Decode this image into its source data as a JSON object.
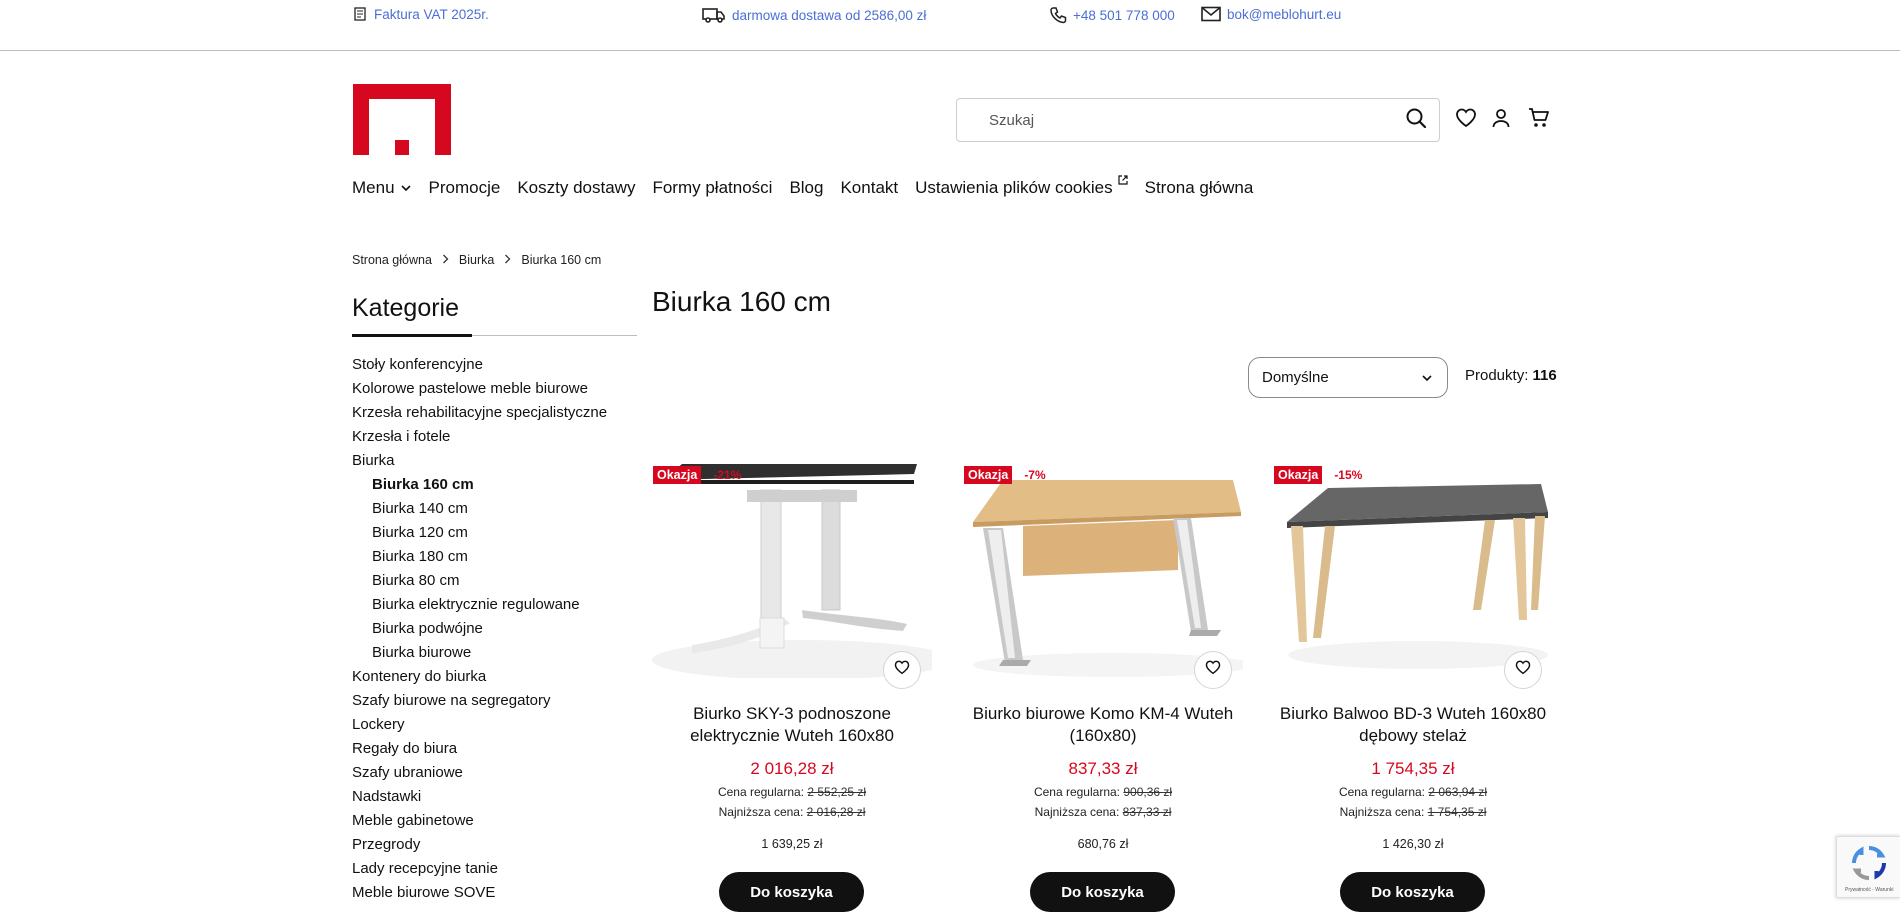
{
  "topbar": {
    "vat": "Faktura VAT 2025r.",
    "delivery": "darmowa dostawa od 2586,00 zł",
    "phone": "+48 501 778 000",
    "email": "bok@meblohurt.eu"
  },
  "colors": {
    "accent": "#d6081f",
    "link": "#4a6fd6",
    "dark": "#111111"
  },
  "header": {
    "logo": "meblohurt-logo",
    "search_placeholder": "Szukaj",
    "icons": [
      "search-icon",
      "heart-icon",
      "user-icon",
      "cart-icon"
    ]
  },
  "nav": {
    "menu": "Menu",
    "items": [
      "Promocje",
      "Koszty dostawy",
      "Formy płatności",
      "Blog",
      "Kontakt",
      "Ustawienia plików cookies",
      "Strona główna"
    ]
  },
  "breadcrumb": [
    "Strona główna",
    "Biurka",
    "Biurka 160 cm"
  ],
  "sidebar": {
    "title": "Kategorie",
    "items": [
      {
        "label": "Stoły konferencyjne"
      },
      {
        "label": "Kolorowe pastelowe meble biurowe"
      },
      {
        "label": "Krzesła rehabilitacyjne specjalistyczne"
      },
      {
        "label": "Krzesła i fotele"
      },
      {
        "label": "Biurka"
      },
      {
        "label": "Biurka 160 cm"
      },
      {
        "label": "Biurka 140 cm"
      },
      {
        "label": "Biurka 120 cm"
      },
      {
        "label": "Biurka 180 cm"
      },
      {
        "label": "Biurka 80 cm"
      },
      {
        "label": "Biurka elektrycznie regulowane"
      },
      {
        "label": "Biurka podwójne"
      },
      {
        "label": "Biurka biurowe"
      },
      {
        "label": "Kontenery do biurka"
      },
      {
        "label": "Szafy biurowe na segregatory"
      },
      {
        "label": "Lockery"
      },
      {
        "label": "Regały do biura"
      },
      {
        "label": "Szafy ubraniowe"
      },
      {
        "label": "Nadstawki"
      },
      {
        "label": "Meble gabinetowe"
      },
      {
        "label": "Przegrody"
      },
      {
        "label": "Lady recepcyjne tanie"
      },
      {
        "label": "Meble biurowe SOVE"
      }
    ]
  },
  "main": {
    "title": "Biurka 160 cm",
    "sort_value": "Domyślne",
    "count_label": "Produkty:",
    "count_value": "116"
  },
  "products": [
    {
      "badge": "Okazja",
      "discount": "-21%",
      "name_line1": "Biurko SKY-3 podnoszone",
      "name_line2": "elektrycznie Wuteh 160x80",
      "price": "2 016,28 zł",
      "regular_label": "Cena regularna:",
      "regular": "2 552,25 zł",
      "lowest_label": "Najniższa cena:",
      "lowest": "2 016,28 zł",
      "net": "1 639,25 zł",
      "button": "Do koszyka"
    },
    {
      "badge": "Okazja",
      "discount": "-7%",
      "name_line1": "Biurko biurowe Komo KM-4 Wuteh",
      "name_line2": "(160x80)",
      "price": "837,33 zł",
      "regular_label": "Cena regularna:",
      "regular": "900,36 zł",
      "lowest_label": "Najniższa cena:",
      "lowest": "837,33 zł",
      "net": "680,76 zł",
      "button": "Do koszyka"
    },
    {
      "badge": "Okazja",
      "discount": "-15%",
      "name_line1": "Biurko Balwoo BD-3 Wuteh 160x80",
      "name_line2": "dębowy stelaż",
      "price": "1 754,35 zł",
      "regular_label": "Cena regularna:",
      "regular": "2 063,94 zł",
      "lowest_label": "Najniższa cena:",
      "lowest": "1 754,35 zł",
      "net": "1 426,30 zł",
      "button": "Do koszyka"
    }
  ],
  "recaptcha": {
    "text": "Prywatność - Warunki"
  }
}
